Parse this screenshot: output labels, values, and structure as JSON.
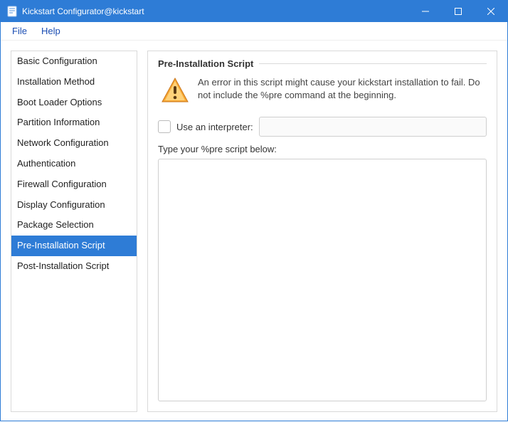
{
  "window": {
    "title": "Kickstart Configurator@kickstart"
  },
  "menubar": {
    "file": "File",
    "help": "Help"
  },
  "sidebar": {
    "items": [
      {
        "label": "Basic Configuration"
      },
      {
        "label": "Installation Method"
      },
      {
        "label": "Boot Loader Options"
      },
      {
        "label": "Partition Information"
      },
      {
        "label": "Network Configuration"
      },
      {
        "label": "Authentication"
      },
      {
        "label": "Firewall Configuration"
      },
      {
        "label": "Display Configuration"
      },
      {
        "label": "Package Selection"
      },
      {
        "label": "Pre-Installation Script"
      },
      {
        "label": "Post-Installation Script"
      }
    ],
    "selected_index": 9
  },
  "panel": {
    "title": "Pre-Installation Script",
    "warning": "An error in this script might cause your kickstart installation to fail. Do not include the %pre command at the beginning.",
    "interpreter_label": "Use an interpreter:",
    "interpreter_value": "",
    "script_label": "Type your %pre script below:",
    "script_value": ""
  }
}
